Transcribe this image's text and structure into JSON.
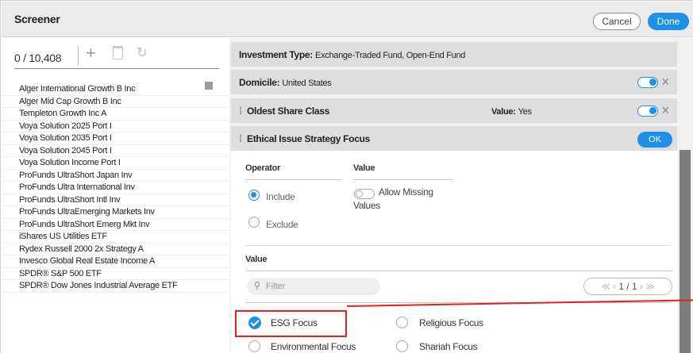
{
  "header": {
    "title": "Screener",
    "cancel_label": "Cancel",
    "done_label": "Done"
  },
  "left": {
    "count": "0 / 10,408",
    "funds": [
      "Alger International Growth B Inc",
      "Alger Mid Cap Growth B Inc",
      "Templeton Growth Inc A",
      "Voya Solution 2025 Port I",
      "Voya Solution 2035 Port I",
      "Voya Solution 2045 Port I",
      "Voya Solution Income Port I",
      "ProFunds UltraShort Japan Inv",
      "ProFunds Ultra International Inv",
      "ProFunds UltraShort Intl Inv",
      "ProFunds UltraEmerging Markets Inv",
      "ProFunds UltraShort Emerg Mkt Inv",
      "iShares US Utilities ETF",
      "Rydex Russell 2000 2x Strategy A",
      "Invesco Global Real Estate Income A",
      "SPDR® S&P 500 ETF",
      "SPDR® Dow Jones Industrial Average ETF"
    ]
  },
  "criteria": {
    "investment_type": {
      "label": "Investment Type:",
      "value": "Exchange-Traded Fund, Open-End Fund"
    },
    "domicile": {
      "label": "Domicile:",
      "value": "United States",
      "enabled": true
    },
    "oldest_share_class": {
      "label": "Oldest Share Class",
      "value_label": "Value:",
      "value": "Yes",
      "enabled": true
    },
    "ethical": {
      "label": "Ethical Issue Strategy Focus",
      "ok_label": "OK",
      "operator_label": "Operator",
      "value_label": "Value",
      "include_label": "Include",
      "exclude_label": "Exclude",
      "allow_missing_label": "Allow Missing",
      "values_label": "Values",
      "value_section_label": "Value",
      "filter_placeholder": "Filter",
      "pager": {
        "prev": "≪ ‹",
        "page": "1 / 1",
        "next": "› ≫"
      },
      "options": [
        {
          "label": "ESG Focus",
          "checked": true
        },
        {
          "label": "Religious Focus",
          "checked": false
        },
        {
          "label": "Environmental Focus",
          "checked": false
        },
        {
          "label": "Shariah Focus",
          "checked": false
        }
      ]
    }
  },
  "colors": {
    "accent": "#1e90e8",
    "highlight": "#e3201b"
  }
}
